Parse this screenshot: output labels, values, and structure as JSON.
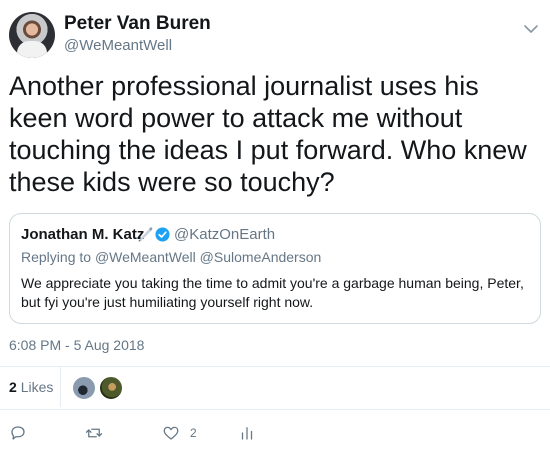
{
  "author": {
    "display_name": "Peter Van Buren",
    "handle": "@WeMeantWell",
    "avatar_icon": "avatar-photo"
  },
  "tweet": {
    "text": "Another professional journalist uses his keen word power to attack me without touching the ideas I put forward. Who knew these kids were so touchy?",
    "timestamp": "6:08 PM - 5 Aug 2018"
  },
  "quoted_tweet": {
    "display_name": "Jonathan M. Katz",
    "handle": "@KatzOnEarth",
    "replying_label": "Replying to",
    "replying_to": [
      "@WeMeantWell",
      "@SulomeAnderson"
    ],
    "text": "We appreciate you taking the time to admit you're a garbage human being, Peter, but fyi you're just humiliating yourself right now."
  },
  "stats": {
    "likes_count": "2",
    "likes_label": "Likes"
  },
  "actions": {
    "like_count": "2"
  },
  "colors": {
    "text_primary": "#14171a",
    "text_secondary": "#657786",
    "verified_blue": "#1da1f2",
    "border": "#e6ecf0"
  }
}
